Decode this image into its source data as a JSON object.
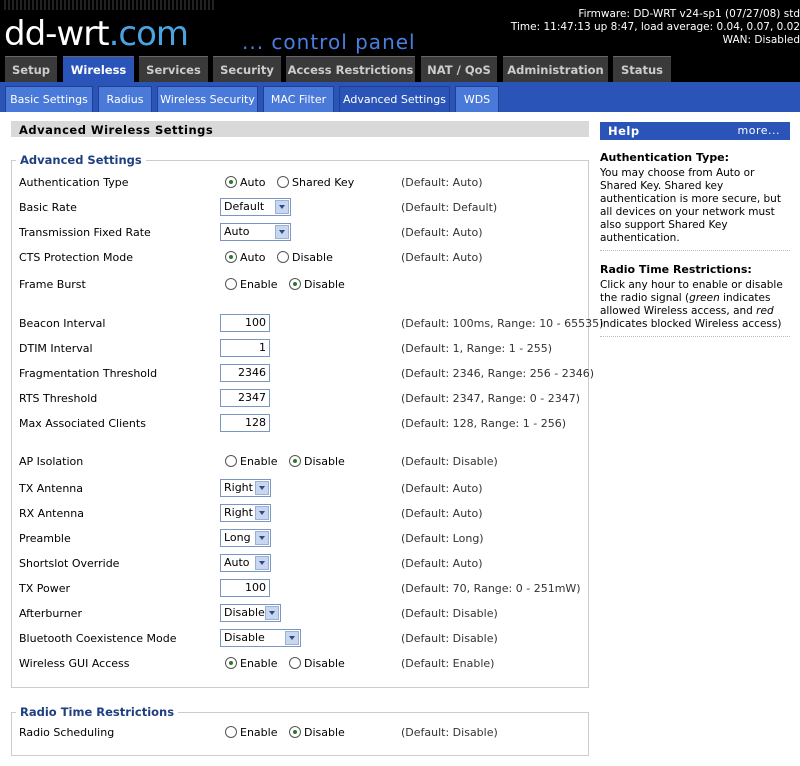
{
  "header": {
    "logo_text": "dd-wrt",
    "logo_suffix": ".com",
    "control_panel": "... control panel",
    "firmware": "Firmware: DD-WRT v24-sp1 (07/27/08) std",
    "time": "Time: 11:47:13 up 8:47, load average: 0.04, 0.07, 0.02",
    "wan": "WAN: Disabled"
  },
  "main_tabs": [
    "Setup",
    "Wireless",
    "Services",
    "Security",
    "Access Restrictions",
    "NAT / QoS",
    "Administration",
    "Status"
  ],
  "sub_tabs": [
    "Basic Settings",
    "Radius",
    "Wireless Security",
    "MAC Filter",
    "Advanced Settings",
    "WDS"
  ],
  "page_title": "Advanced Wireless Settings",
  "advanced": {
    "legend": "Advanced Settings",
    "auth_type": {
      "label": "Authentication Type",
      "opt1": "Auto",
      "opt2": "Shared Key",
      "default": "(Default: Auto)"
    },
    "basic_rate": {
      "label": "Basic Rate",
      "value": "Default",
      "default": "(Default: Default)"
    },
    "tx_fixed_rate": {
      "label": "Transmission Fixed Rate",
      "value": "Auto",
      "default": "(Default: Auto)"
    },
    "cts": {
      "label": "CTS Protection Mode",
      "opt1": "Auto",
      "opt2": "Disable",
      "default": "(Default: Auto)"
    },
    "frame_burst": {
      "label": "Frame Burst",
      "opt1": "Enable",
      "opt2": "Disable"
    },
    "beacon": {
      "label": "Beacon Interval",
      "value": "100",
      "default": "(Default: 100ms, Range: 10 - 65535)"
    },
    "dtim": {
      "label": "DTIM Interval",
      "value": "1",
      "default": "(Default: 1, Range: 1 - 255)"
    },
    "frag": {
      "label": "Fragmentation Threshold",
      "value": "2346",
      "default": "(Default: 2346, Range: 256 - 2346)"
    },
    "rts": {
      "label": "RTS Threshold",
      "value": "2347",
      "default": "(Default: 2347, Range: 0 - 2347)"
    },
    "max_clients": {
      "label": "Max Associated Clients",
      "value": "128",
      "default": "(Default: 128, Range: 1 - 256)"
    },
    "ap_isolation": {
      "label": "AP Isolation",
      "opt1": "Enable",
      "opt2": "Disable",
      "default": "(Default: Disable)"
    },
    "tx_antenna": {
      "label": "TX Antenna",
      "value": "Right",
      "default": "(Default: Auto)"
    },
    "rx_antenna": {
      "label": "RX Antenna",
      "value": "Right",
      "default": "(Default: Auto)"
    },
    "preamble": {
      "label": "Preamble",
      "value": "Long",
      "default": "(Default: Long)"
    },
    "shortslot": {
      "label": "Shortslot Override",
      "value": "Auto",
      "default": "(Default: Auto)"
    },
    "tx_power": {
      "label": "TX Power",
      "value": "100",
      "default": "(Default: 70, Range: 0 - 251mW)"
    },
    "afterburner": {
      "label": "Afterburner",
      "value": "Disable",
      "default": "(Default: Disable)"
    },
    "bluetooth": {
      "label": "Bluetooth Coexistence Mode",
      "value": "Disable",
      "default": "(Default: Disable)"
    },
    "gui_access": {
      "label": "Wireless GUI Access",
      "opt1": "Enable",
      "opt2": "Disable",
      "default": "(Default: Enable)"
    }
  },
  "radio_time": {
    "legend": "Radio Time Restrictions",
    "scheduling": {
      "label": "Radio Scheduling",
      "opt1": "Enable",
      "opt2": "Disable",
      "default": "(Default: Disable)"
    }
  },
  "help": {
    "title": "Help",
    "more": "more...",
    "auth_title": "Authentication Type:",
    "auth_text": "You may choose from Auto or Shared Key. Shared key authentication is more secure, but all devices on your network must also support Shared Key authentication.",
    "radio_title": "Radio Time Restrictions:",
    "radio_text_1": "Click any hour to enable or disable the radio signal (",
    "radio_text_green": "green",
    "radio_text_2": " indicates allowed Wireless access, and ",
    "radio_text_red": "red",
    "radio_text_3": " indicates blocked Wireless access)"
  },
  "colors": {
    "accent_blue": "#2a54b8",
    "header_bg": "#000000",
    "radio_on": "#2a7a2a"
  }
}
